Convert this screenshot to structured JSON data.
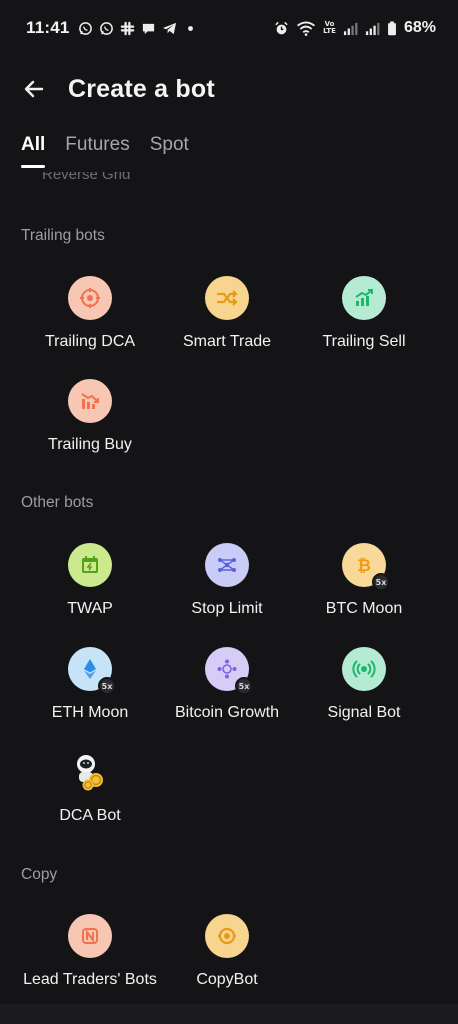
{
  "status_bar": {
    "time": "11:41",
    "left_icons": [
      "whatsapp-icon",
      "whatsapp-icon",
      "slack-icon",
      "chat-icon",
      "telegram-icon",
      "dot-icon"
    ],
    "right_icons": [
      "alarm-icon",
      "wifi-icon",
      "volte-icon",
      "signal-icon",
      "signal-icon",
      "battery-icon"
    ],
    "volte_line1": "Vo",
    "volte_line2": "LTE",
    "battery": "68%"
  },
  "header": {
    "title": "Create a bot"
  },
  "tabs": [
    {
      "label": "All",
      "active": true
    },
    {
      "label": "Futures",
      "active": false
    },
    {
      "label": "Spot",
      "active": false
    }
  ],
  "cutoff_text": "Reverse Grid",
  "sections": {
    "trailing": {
      "title": "Trailing bots",
      "bots": [
        {
          "label": "Trailing DCA",
          "icon": "target-icon",
          "color": "#f7c7b4",
          "fg": "#f0724f"
        },
        {
          "label": "Smart Trade",
          "icon": "smart-trade-icon",
          "color": "#f8d58e",
          "fg": "#e69a16"
        },
        {
          "label": "Trailing Sell",
          "icon": "trend-up-icon",
          "color": "#b6ebd3",
          "fg": "#1bb86c"
        },
        {
          "label": "Trailing Buy",
          "icon": "trend-down-icon",
          "color": "#f7c7b4",
          "fg": "#f0724f"
        }
      ]
    },
    "other": {
      "title": "Other bots",
      "bots": [
        {
          "label": "TWAP",
          "icon": "calendar-icon",
          "color": "#cde98d",
          "fg": "#53a21a"
        },
        {
          "label": "Stop Limit",
          "icon": "network-icon",
          "color": "#c9ccf6",
          "fg": "#5a62e0"
        },
        {
          "label": "BTC Moon",
          "icon": "bitcoin-icon",
          "color": "#f8d99a",
          "fg": "#f29a12",
          "badge": "5x"
        },
        {
          "label": "ETH Moon",
          "icon": "ethereum-icon",
          "color": "#c6e3f8",
          "fg": "#2a8ee6",
          "badge": "5x"
        },
        {
          "label": "Bitcoin Growth",
          "icon": "growth-icon",
          "color": "#d6cdf7",
          "fg": "#7a63e6",
          "badge": "5x"
        },
        {
          "label": "Signal Bot",
          "icon": "signal-broadcast-icon",
          "color": "#b6ebd3",
          "fg": "#1bb86c"
        },
        {
          "label": "DCA Bot",
          "icon": "astronaut-icon",
          "color": "#141416",
          "fg": "#f2c03a"
        }
      ]
    },
    "copy": {
      "title": "Copy",
      "bots": [
        {
          "label": "Lead Traders' Bots",
          "icon": "lead-trader-icon",
          "color": "#f7c7b4",
          "fg": "#f0724f"
        },
        {
          "label": "CopyBot",
          "icon": "copy-icon",
          "color": "#f8d58e",
          "fg": "#e69a16"
        }
      ]
    }
  }
}
